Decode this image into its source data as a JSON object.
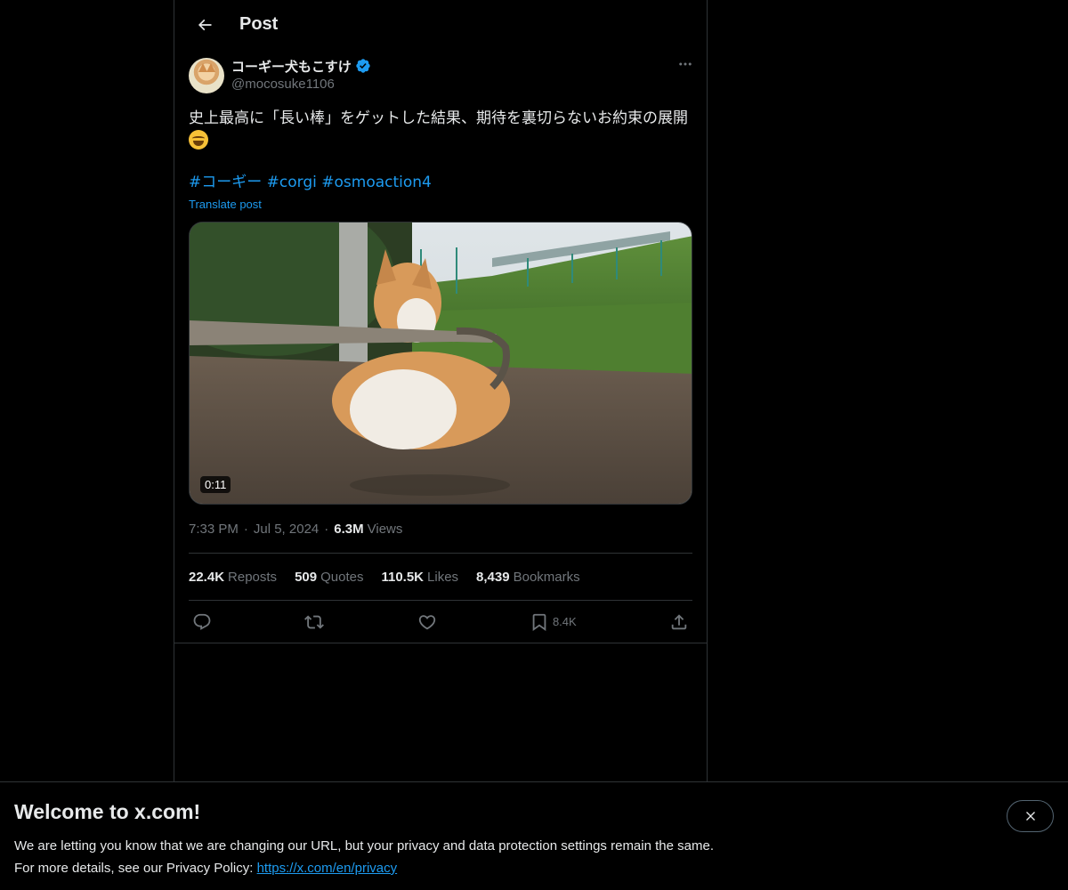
{
  "header": {
    "title": "Post",
    "back_icon": "arrow-left-icon"
  },
  "author": {
    "display_name": "コーギー犬もこすけ",
    "handle": "@mocosuke1106",
    "verified_icon": "verified-badge-icon",
    "verified_color": "#1d9bf0"
  },
  "post": {
    "text": "史上最高に「長い棒」をゲットした結果、期待を裏切らないお約束の展開",
    "emoji": "face-with-tears-of-joy-emoji",
    "hashtags": [
      "#コーギー",
      "#corgi",
      "#osmoaction4"
    ],
    "translate_label": "Translate post",
    "video_duration": "0:11",
    "time": "7:33 PM",
    "date": "Jul 5, 2024",
    "views_count": "6.3M",
    "views_label": "Views"
  },
  "stats": [
    {
      "num": "22.4K",
      "label": "Reposts"
    },
    {
      "num": "509",
      "label": "Quotes"
    },
    {
      "num": "110.5K",
      "label": "Likes"
    },
    {
      "num": "8,439",
      "label": "Bookmarks"
    }
  ],
  "actions": {
    "reply_icon": "reply-icon",
    "repost_icon": "repost-icon",
    "like_icon": "heart-icon",
    "bookmark_icon": "bookmark-icon",
    "bookmark_count": "8.4K",
    "share_icon": "share-icon"
  },
  "banner": {
    "title": "Welcome to x.com!",
    "line1": "We are letting you know that we are changing our URL, but your privacy and data protection settings remain the same.",
    "line2_prefix": "For more details, see our Privacy Policy: ",
    "link": "https://x.com/en/privacy",
    "close_icon": "close-icon"
  },
  "colors": {
    "accent": "#1d9bf0",
    "background": "#000000",
    "muted": "#71767b",
    "border": "#2f3336"
  }
}
